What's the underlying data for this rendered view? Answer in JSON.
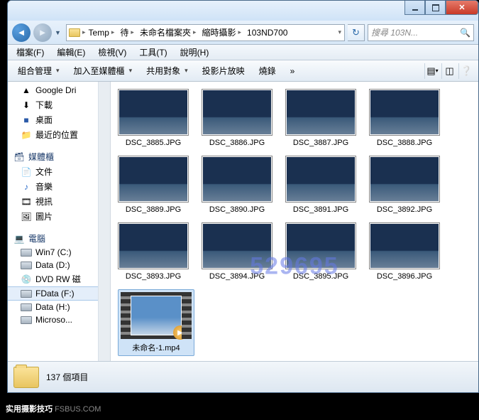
{
  "breadcrumb": {
    "segs": [
      "Temp",
      "待",
      "未命名檔案夾",
      "縮時攝影",
      "103ND700"
    ]
  },
  "search": {
    "placeholder": "搜尋 103N..."
  },
  "menubar": {
    "items": [
      "檔案(F)",
      "編輯(E)",
      "檢視(V)",
      "工具(T)",
      "說明(H)"
    ]
  },
  "toolbar": {
    "organize": "組合管理",
    "include": "加入至媒體櫃",
    "share": "共用對象",
    "slideshow": "投影片放映",
    "burn": "燒錄"
  },
  "sidebar": {
    "fav": [
      {
        "icon": "gdrive",
        "label": "Google Dri"
      },
      {
        "icon": "download",
        "label": "下載"
      },
      {
        "icon": "desktop",
        "label": "桌面"
      },
      {
        "icon": "recent",
        "label": "最近的位置"
      }
    ],
    "lib_header": "媒體櫃",
    "lib": [
      {
        "icon": "doc",
        "label": "文件"
      },
      {
        "icon": "music",
        "label": "音樂"
      },
      {
        "icon": "video",
        "label": "視訊"
      },
      {
        "icon": "picture",
        "label": "圖片"
      }
    ],
    "pc_header": "電腦",
    "pc": [
      {
        "icon": "drive",
        "label": "Win7 (C:)"
      },
      {
        "icon": "drive",
        "label": "Data (D:)"
      },
      {
        "icon": "dvd",
        "label": "DVD RW 磁"
      },
      {
        "icon": "drive",
        "label": "FData (F:)"
      },
      {
        "icon": "drive",
        "label": "Data (H:)"
      },
      {
        "icon": "drive",
        "label": "Microso..."
      }
    ]
  },
  "files": {
    "images": [
      "DSC_3885.JPG",
      "DSC_3886.JPG",
      "DSC_3887.JPG",
      "DSC_3888.JPG",
      "DSC_3889.JPG",
      "DSC_3890.JPG",
      "DSC_3891.JPG",
      "DSC_3892.JPG",
      "DSC_3893.JPG",
      "DSC_3894.JPG",
      "DSC_3895.JPG",
      "DSC_3896.JPG"
    ],
    "video": "未命名-1.mp4"
  },
  "status": {
    "count_label": "137 個項目"
  },
  "watermark": "529695",
  "footer": {
    "brand": "实用摄影技巧",
    "site": "FsBus.CoM"
  }
}
